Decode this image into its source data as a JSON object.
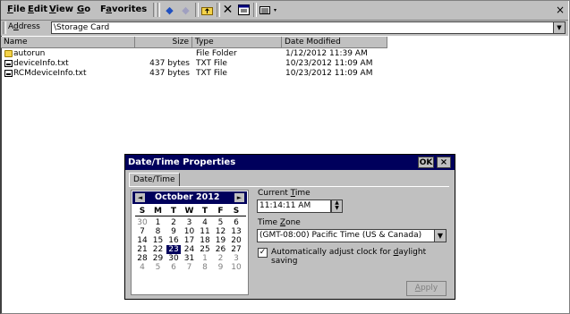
{
  "menubar": {
    "items": [
      {
        "label": "File",
        "accel": "F",
        "rest": "ile"
      },
      {
        "label": "Edit",
        "accel": "E",
        "rest": "dit"
      },
      {
        "label": "View",
        "accel": "V",
        "rest": "iew"
      },
      {
        "label": "Go",
        "accel": "G",
        "rest": "o"
      },
      {
        "label": "Favorites",
        "prefix": "F",
        "accel": "a",
        "rest": "vorites"
      }
    ],
    "toolbar_icons": [
      "back-arrow-icon",
      "forward-arrow-icon",
      "up-folder-icon",
      "delete-x-icon",
      "properties-icon",
      "views-icon"
    ],
    "close_glyph": "×"
  },
  "address": {
    "label_prefix": "A",
    "label_accel": "d",
    "label_rest": "dress",
    "value": "\\Storage Card"
  },
  "columns": [
    "Name",
    "Size",
    "Type",
    "Date Modified"
  ],
  "files": [
    {
      "name": "autorun",
      "size": "",
      "type": "File Folder",
      "modified": "1/12/2012 11:39 AM",
      "icon": "folder-icon"
    },
    {
      "name": "deviceInfo.txt",
      "size": "437 bytes",
      "type": "TXT File",
      "modified": "10/23/2012 11:09 AM",
      "icon": "text-file-icon"
    },
    {
      "name": "RCMdeviceInfo.txt",
      "size": "437 bytes",
      "type": "TXT File",
      "modified": "10/23/2012 11:09 AM",
      "icon": "text-file-icon"
    }
  ],
  "dialog": {
    "title": "Date/Time Properties",
    "ok": "OK",
    "close": "×",
    "tab": "Date/Time",
    "calendar": {
      "month_year": "October 2012",
      "prev": "◄",
      "next": "►",
      "weekdays": [
        "S",
        "M",
        "T",
        "W",
        "T",
        "F",
        "S"
      ],
      "weeks": [
        [
          "30",
          "1",
          "2",
          "3",
          "4",
          "5",
          "6"
        ],
        [
          "7",
          "8",
          "9",
          "10",
          "11",
          "12",
          "13"
        ],
        [
          "14",
          "15",
          "16",
          "17",
          "18",
          "19",
          "20"
        ],
        [
          "21",
          "22",
          "23",
          "24",
          "25",
          "26",
          "27"
        ],
        [
          "28",
          "29",
          "30",
          "31",
          "1",
          "2",
          "3"
        ],
        [
          "4",
          "5",
          "6",
          "7",
          "8",
          "9",
          "10"
        ]
      ],
      "selected": "23"
    },
    "current_time_label_pre": "Current ",
    "current_time_label_accel": "T",
    "current_time_label_rest": "ime",
    "time_value": "11:14:11 AM",
    "time_zone_label_pre": "Time ",
    "time_zone_label_accel": "Z",
    "time_zone_label_rest": "one",
    "time_zone_value": "(GMT-08:00) Pacific Time (US & Canada)",
    "dst_pre": "Automatically adjust clock for ",
    "dst_accel": "d",
    "dst_rest": "aylight saving",
    "dst_checked": "✓",
    "apply_pre": "",
    "apply_accel": "A",
    "apply_rest": "pply"
  }
}
